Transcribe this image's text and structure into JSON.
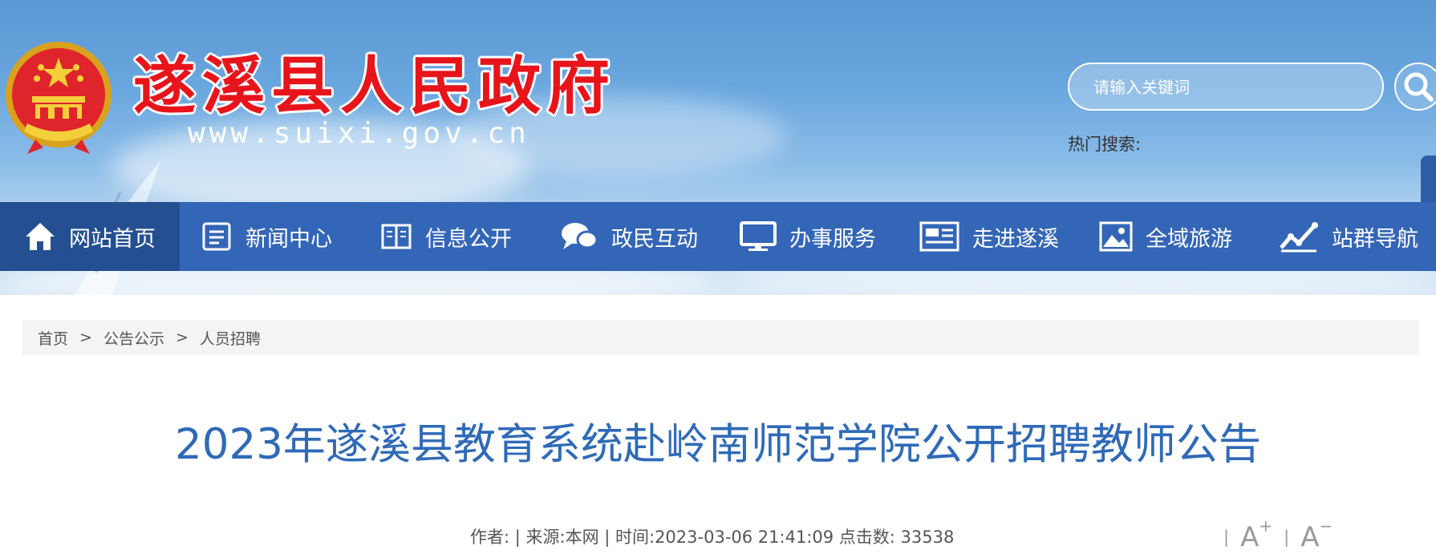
{
  "header": {
    "site_title": "遂溪县人民政府",
    "site_url": "www.suixi.gov.cn",
    "search_placeholder": "请输入关键词",
    "hot_search_label": "热门搜索:"
  },
  "nav": {
    "items": [
      {
        "label": "网站首页",
        "icon": "home-icon",
        "active": true
      },
      {
        "label": "新闻中心",
        "icon": "news-icon"
      },
      {
        "label": "信息公开",
        "icon": "book-icon"
      },
      {
        "label": "政民互动",
        "icon": "chat-icon"
      },
      {
        "label": "办事服务",
        "icon": "monitor-icon"
      },
      {
        "label": "走进遂溪",
        "icon": "newspaper-icon"
      },
      {
        "label": "全域旅游",
        "icon": "image-icon"
      },
      {
        "label": "站群导航",
        "icon": "chart-icon"
      }
    ]
  },
  "breadcrumb": {
    "items": [
      "首页",
      "公告公示",
      "人员招聘"
    ],
    "separator": ">"
  },
  "article": {
    "title": "2023年遂溪县教育系统赴岭南师范学院公开招聘教师公告",
    "meta": "作者:  | 来源:本网 | 时间:2023-03-06 21:41:09 点击数: 33538"
  },
  "font_tools": {
    "separator": "|",
    "increase_symbol": "+",
    "decrease_symbol": "−",
    "letter": "A"
  },
  "colors": {
    "nav_bg": "#3466b7",
    "nav_active_bg": "#244f91",
    "title_red": "#e8141b",
    "article_title": "#2f6ab8"
  }
}
